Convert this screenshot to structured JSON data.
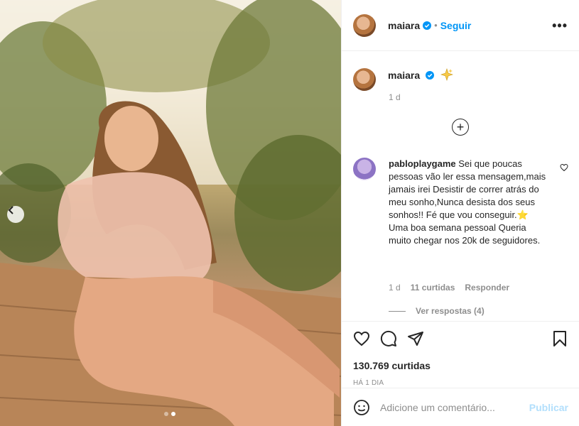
{
  "post": {
    "images": {
      "current_index": 2,
      "count": 2,
      "prev_icon": "chevron-left-icon"
    }
  },
  "header": {
    "username": "maiara",
    "separator": "•",
    "follow_label": "Seguir",
    "more_icon": "more-options-icon",
    "more_glyph": "•••"
  },
  "caption": {
    "username": "maiara",
    "emoji_icon": "sparkle-icon",
    "time": "1 d"
  },
  "comment": {
    "username": "pabloplaygame",
    "text": "Sei que poucas pessoas vão ler essa mensagem,mais jamais irei Desistir de correr atrás do meu sonho,Nunca desista dos seus sonhos!! Fé que vou conseguir.⭐ Uma boa semana pessoal Queria muito chegar nos 20k de seguidores.",
    "time": "1 d",
    "likes": "11 curtidas",
    "reply_label": "Responder",
    "view_replies": "Ver respostas (4)"
  },
  "load_more_glyph": "+",
  "actions": {
    "likes_count": "130.769 curtidas",
    "posted_ago": "HÁ 1 DIA"
  },
  "add_comment": {
    "placeholder": "Adicione um comentário...",
    "publish_label": "Publicar"
  },
  "colors": {
    "accent": "#0095f6",
    "publish_disabled": "#b2dffc",
    "muted": "#8e8e8e",
    "text": "#262626"
  }
}
